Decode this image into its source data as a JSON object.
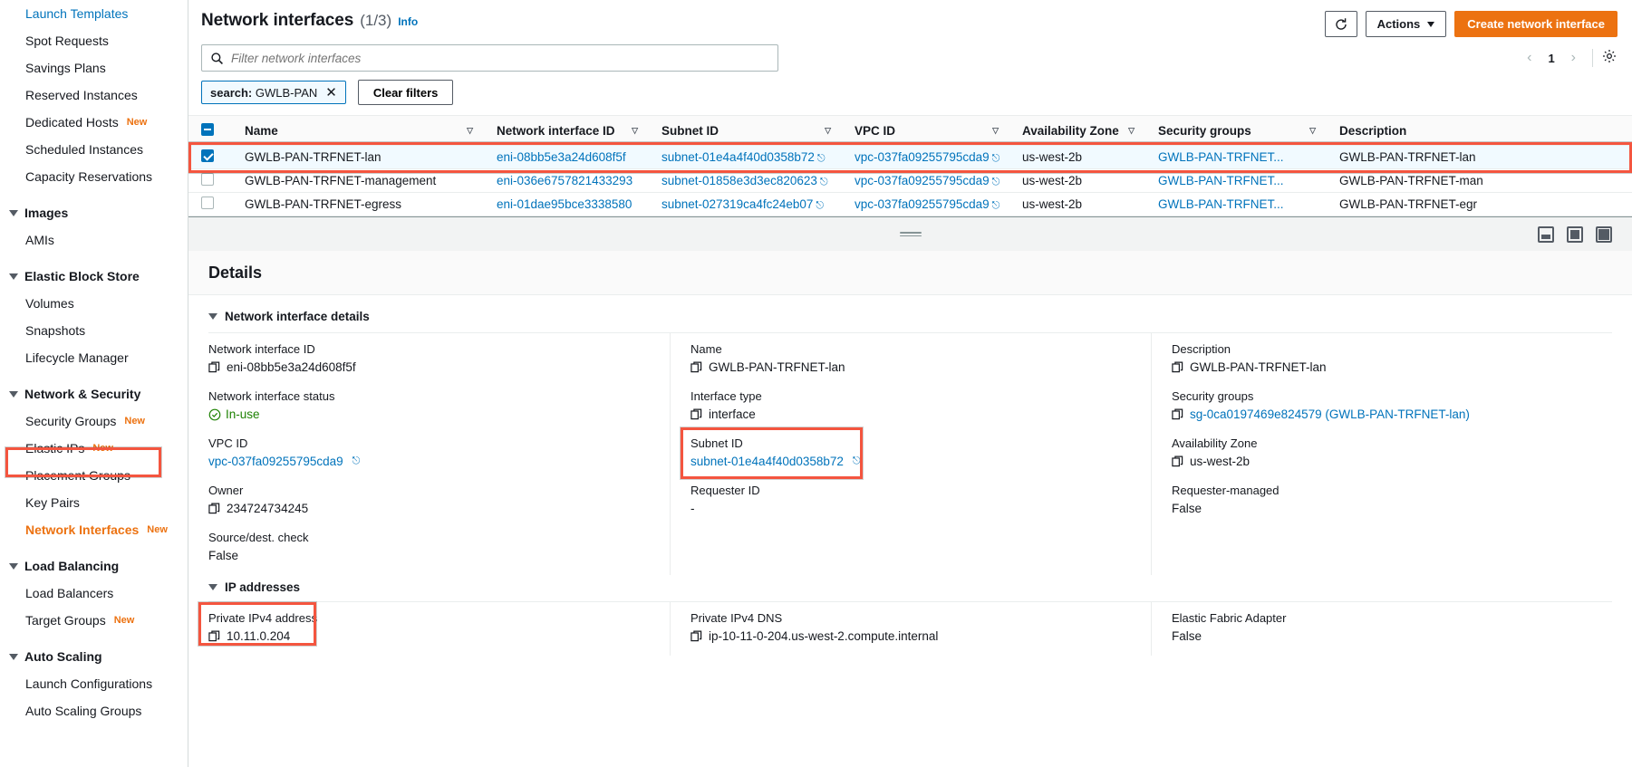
{
  "sidebar": {
    "items": [
      {
        "label": "Launch Templates",
        "type": "item"
      },
      {
        "label": "Spot Requests",
        "type": "item"
      },
      {
        "label": "Savings Plans",
        "type": "item"
      },
      {
        "label": "Reserved Instances",
        "type": "item"
      },
      {
        "label": "Dedicated Hosts",
        "type": "item",
        "badge": "New"
      },
      {
        "label": "Scheduled Instances",
        "type": "item"
      },
      {
        "label": "Capacity Reservations",
        "type": "item"
      },
      {
        "label": "Images",
        "type": "group"
      },
      {
        "label": "AMIs",
        "type": "item"
      },
      {
        "label": "Elastic Block Store",
        "type": "group"
      },
      {
        "label": "Volumes",
        "type": "item"
      },
      {
        "label": "Snapshots",
        "type": "item"
      },
      {
        "label": "Lifecycle Manager",
        "type": "item"
      },
      {
        "label": "Network & Security",
        "type": "group"
      },
      {
        "label": "Security Groups",
        "type": "item",
        "badge": "New"
      },
      {
        "label": "Elastic IPs",
        "type": "item",
        "badge": "New"
      },
      {
        "label": "Placement Groups",
        "type": "item"
      },
      {
        "label": "Key Pairs",
        "type": "item"
      },
      {
        "label": "Network Interfaces",
        "type": "item",
        "badge": "New",
        "active": true
      },
      {
        "label": "Load Balancing",
        "type": "group"
      },
      {
        "label": "Load Balancers",
        "type": "item"
      },
      {
        "label": "Target Groups",
        "type": "item",
        "badge": "New"
      },
      {
        "label": "Auto Scaling",
        "type": "group"
      },
      {
        "label": "Launch Configurations",
        "type": "item"
      },
      {
        "label": "Auto Scaling Groups",
        "type": "item"
      }
    ]
  },
  "header": {
    "title": "Network interfaces",
    "counter": "(1/3)",
    "info_label": "Info",
    "refresh_icon": "refresh-icon",
    "actions_label": "Actions",
    "create_label": "Create network interface"
  },
  "search": {
    "placeholder": "Filter network interfaces",
    "icon": "search-icon"
  },
  "pagination": {
    "prev": "‹",
    "page": "1",
    "next": "›",
    "settings_icon": "gear-icon"
  },
  "filters": {
    "token_prefix": "search:",
    "token_value": "GWLB-PAN",
    "token_remove_icon": "close-icon",
    "clear_label": "Clear filters"
  },
  "table": {
    "columns": [
      {
        "label": "Name",
        "sortable": true
      },
      {
        "label": "Network interface ID",
        "sortable": true
      },
      {
        "label": "Subnet ID",
        "sortable": true
      },
      {
        "label": "VPC ID",
        "sortable": true
      },
      {
        "label": "Availability Zone",
        "sortable": true
      },
      {
        "label": "Security groups",
        "sortable": true
      },
      {
        "label": "Description",
        "sortable": false
      }
    ],
    "rows": [
      {
        "selected": true,
        "name": "GWLB-PAN-TRFNET-lan",
        "eni": "eni-08bb5e3a24d608f5f",
        "subnet": "subnet-01e4a4f40d0358b72",
        "vpc": "vpc-037fa09255795cda9",
        "az": "us-west-2b",
        "sg": "GWLB-PAN-TRFNET...",
        "description": "GWLB-PAN-TRFNET-lan"
      },
      {
        "selected": false,
        "name": "GWLB-PAN-TRFNET-management",
        "eni": "eni-036e6757821433293",
        "subnet": "subnet-01858e3d3ec820623",
        "vpc": "vpc-037fa09255795cda9",
        "az": "us-west-2b",
        "sg": "GWLB-PAN-TRFNET...",
        "description": "GWLB-PAN-TRFNET-man"
      },
      {
        "selected": false,
        "name": "GWLB-PAN-TRFNET-egress",
        "eni": "eni-01dae95bce3338580",
        "subnet": "subnet-027319ca4fc24eb07",
        "vpc": "vpc-037fa09255795cda9",
        "az": "us-west-2b",
        "sg": "GWLB-PAN-TRFNET...",
        "description": "GWLB-PAN-TRFNET-egr"
      }
    ]
  },
  "splitter": {
    "drag_handle": "drag-handle",
    "view_bottom": "split-panel-bottom-icon",
    "view_side": "split-panel-side-icon",
    "view_full": "split-panel-full-icon"
  },
  "details": {
    "title": "Details",
    "section1_label": "Network interface details",
    "section2_label": "IP addresses",
    "fields": {
      "eni_label": "Network interface ID",
      "eni_value": "eni-08bb5e3a24d608f5f",
      "name_label": "Name",
      "name_value": "GWLB-PAN-TRFNET-lan",
      "description_label": "Description",
      "description_value": "GWLB-PAN-TRFNET-lan",
      "status_label": "Network interface status",
      "status_value": "In-use",
      "iftype_label": "Interface type",
      "iftype_value": "interface",
      "sg_label": "Security groups",
      "sg_value": "sg-0ca0197469e824579 (GWLB-PAN-TRFNET-lan)",
      "vpc_label": "VPC ID",
      "vpc_value": "vpc-037fa09255795cda9",
      "subnet_label": "Subnet ID",
      "subnet_value": "subnet-01e4a4f40d0358b72",
      "az_label": "Availability Zone",
      "az_value": "us-west-2b",
      "owner_label": "Owner",
      "owner_value": "234724734245",
      "requester_label": "Requester ID",
      "requester_value": "-",
      "reqmanaged_label": "Requester-managed",
      "reqmanaged_value": "False",
      "srcdest_label": "Source/dest. check",
      "srcdest_value": "False",
      "privip_label": "Private IPv4 address",
      "privip_value": "10.11.0.204",
      "privdns_label": "Private IPv4 DNS",
      "privdns_value": "ip-10-11-0-204.us-west-2.compute.internal",
      "efa_label": "Elastic Fabric Adapter",
      "efa_value": "False"
    }
  },
  "colors": {
    "accent_orange": "#ec7211",
    "link_blue": "#0073bb",
    "highlight_red": "#f4553f",
    "status_green": "#1d8102"
  }
}
